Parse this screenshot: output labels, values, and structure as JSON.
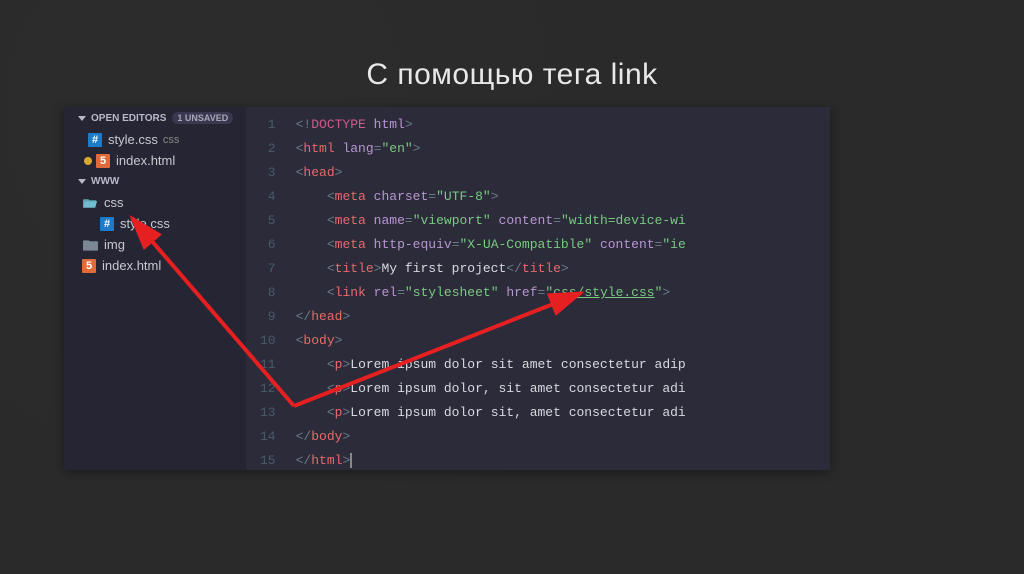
{
  "title": "С помощью тега link",
  "sidebar": {
    "openEditorsLabel": "OPEN EDITORS",
    "unsavedBadge": "1 UNSAVED",
    "wwwLabel": "WWW",
    "openFiles": [
      {
        "name": "style.css",
        "hint": "css",
        "icon": "css",
        "modified": false
      },
      {
        "name": "index.html",
        "hint": "",
        "icon": "html",
        "modified": true
      }
    ],
    "tree": [
      {
        "name": "css",
        "icon": "folder-open",
        "indent": 0
      },
      {
        "name": "style.css",
        "icon": "css",
        "indent": 1
      },
      {
        "name": "img",
        "icon": "folder",
        "indent": 0
      },
      {
        "name": "index.html",
        "icon": "html",
        "indent": 0
      }
    ]
  },
  "code": {
    "lines": [
      [
        {
          "t": "<!",
          "c": "gray"
        },
        {
          "t": "DOCTYPE",
          "c": "pink"
        },
        {
          "t": " ",
          "c": "gray"
        },
        {
          "t": "html",
          "c": "purple"
        },
        {
          "t": ">",
          "c": "gray"
        }
      ],
      [
        {
          "t": "<",
          "c": "gray"
        },
        {
          "t": "html",
          "c": "red"
        },
        {
          "t": " ",
          "c": "text"
        },
        {
          "t": "lang",
          "c": "purple"
        },
        {
          "t": "=",
          "c": "gray"
        },
        {
          "t": "\"en\"",
          "c": "green"
        },
        {
          "t": ">",
          "c": "gray"
        }
      ],
      [
        {
          "t": "<",
          "c": "gray"
        },
        {
          "t": "head",
          "c": "red"
        },
        {
          "t": ">",
          "c": "gray"
        }
      ],
      [
        {
          "t": "    ",
          "c": "text"
        },
        {
          "t": "<",
          "c": "gray"
        },
        {
          "t": "meta",
          "c": "red"
        },
        {
          "t": " ",
          "c": "text"
        },
        {
          "t": "charset",
          "c": "purple"
        },
        {
          "t": "=",
          "c": "gray"
        },
        {
          "t": "\"UTF-8\"",
          "c": "green"
        },
        {
          "t": ">",
          "c": "gray"
        }
      ],
      [
        {
          "t": "    ",
          "c": "text"
        },
        {
          "t": "<",
          "c": "gray"
        },
        {
          "t": "meta",
          "c": "red"
        },
        {
          "t": " ",
          "c": "text"
        },
        {
          "t": "name",
          "c": "purple"
        },
        {
          "t": "=",
          "c": "gray"
        },
        {
          "t": "\"viewport\"",
          "c": "green"
        },
        {
          "t": " ",
          "c": "text"
        },
        {
          "t": "content",
          "c": "purple"
        },
        {
          "t": "=",
          "c": "gray"
        },
        {
          "t": "\"width=device-wi",
          "c": "green"
        }
      ],
      [
        {
          "t": "    ",
          "c": "text"
        },
        {
          "t": "<",
          "c": "gray"
        },
        {
          "t": "meta",
          "c": "red"
        },
        {
          "t": " ",
          "c": "text"
        },
        {
          "t": "http-equiv",
          "c": "purple"
        },
        {
          "t": "=",
          "c": "gray"
        },
        {
          "t": "\"X-UA-Compatible\"",
          "c": "green"
        },
        {
          "t": " ",
          "c": "text"
        },
        {
          "t": "content",
          "c": "purple"
        },
        {
          "t": "=",
          "c": "gray"
        },
        {
          "t": "\"ie",
          "c": "green"
        }
      ],
      [
        {
          "t": "    ",
          "c": "text"
        },
        {
          "t": "<",
          "c": "gray"
        },
        {
          "t": "title",
          "c": "red"
        },
        {
          "t": ">",
          "c": "gray"
        },
        {
          "t": "My first project",
          "c": "text"
        },
        {
          "t": "</",
          "c": "gray"
        },
        {
          "t": "title",
          "c": "red"
        },
        {
          "t": ">",
          "c": "gray"
        }
      ],
      [
        {
          "t": "    ",
          "c": "text"
        },
        {
          "t": "<",
          "c": "gray"
        },
        {
          "t": "link",
          "c": "red"
        },
        {
          "t": " ",
          "c": "text"
        },
        {
          "t": "rel",
          "c": "purple"
        },
        {
          "t": "=",
          "c": "gray"
        },
        {
          "t": "\"stylesheet\"",
          "c": "green"
        },
        {
          "t": " ",
          "c": "text"
        },
        {
          "t": "href",
          "c": "purple"
        },
        {
          "t": "=",
          "c": "gray"
        },
        {
          "t": "\"",
          "c": "green"
        },
        {
          "t": "css/style.css",
          "c": "green",
          "u": true
        },
        {
          "t": "\"",
          "c": "green"
        },
        {
          "t": ">",
          "c": "gray"
        }
      ],
      [
        {
          "t": "</",
          "c": "gray"
        },
        {
          "t": "head",
          "c": "red"
        },
        {
          "t": ">",
          "c": "gray"
        }
      ],
      [
        {
          "t": "<",
          "c": "gray"
        },
        {
          "t": "body",
          "c": "red"
        },
        {
          "t": ">",
          "c": "gray"
        }
      ],
      [
        {
          "t": "    ",
          "c": "text"
        },
        {
          "t": "<",
          "c": "gray"
        },
        {
          "t": "p",
          "c": "red"
        },
        {
          "t": ">",
          "c": "gray"
        },
        {
          "t": "Lorem ipsum dolor sit amet consectetur adip",
          "c": "text"
        }
      ],
      [
        {
          "t": "    ",
          "c": "text"
        },
        {
          "t": "<",
          "c": "gray"
        },
        {
          "t": "p",
          "c": "red"
        },
        {
          "t": ">",
          "c": "gray"
        },
        {
          "t": "Lorem ipsum dolor, sit amet consectetur adi",
          "c": "text"
        }
      ],
      [
        {
          "t": "    ",
          "c": "text"
        },
        {
          "t": "<",
          "c": "gray"
        },
        {
          "t": "p",
          "c": "red"
        },
        {
          "t": ">",
          "c": "gray"
        },
        {
          "t": "Lorem ipsum dolor sit, amet consectetur adi",
          "c": "text"
        }
      ],
      [
        {
          "t": "</",
          "c": "gray"
        },
        {
          "t": "body",
          "c": "red"
        },
        {
          "t": ">",
          "c": "gray"
        }
      ],
      [
        {
          "t": "</",
          "c": "gray"
        },
        {
          "t": "html",
          "c": "red"
        },
        {
          "t": ">",
          "c": "gray"
        }
      ]
    ]
  }
}
